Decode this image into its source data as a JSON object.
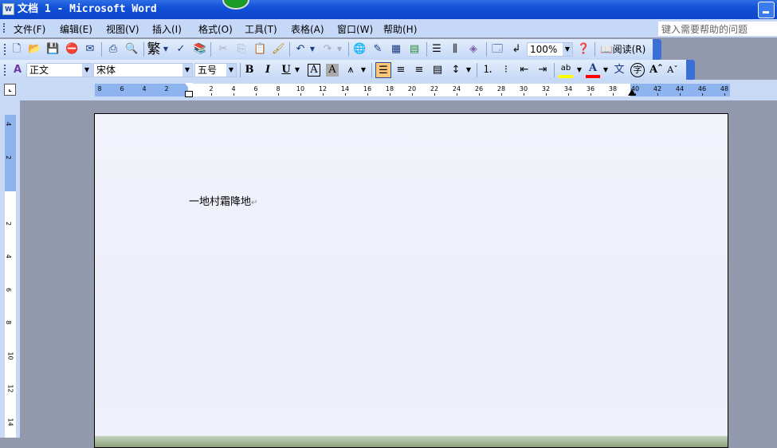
{
  "window": {
    "title": "文档 1 - Microsoft Word",
    "app_icon": "W"
  },
  "menu": [
    "文件(F)",
    "编辑(E)",
    "视图(V)",
    "插入(I)",
    "格式(O)",
    "工具(T)",
    "表格(A)",
    "窗口(W)",
    "帮助(H)"
  ],
  "help_placeholder": "键入需要帮助的问题",
  "standard_toolbar": {
    "zoom": "100%",
    "read_label": "阅读(R)",
    "traditional": "繁"
  },
  "format_toolbar": {
    "style": "正文",
    "font": "宋体",
    "size": "五号",
    "bold": "B",
    "italic": "I",
    "underline": "U",
    "char_border": "A",
    "char_shade": "A",
    "font_color": "A",
    "highlight_color": "#ffff00",
    "font_color_value": "#ff0000",
    "phonetic": "文",
    "enclose": "字"
  },
  "hruler": {
    "left_labels": [
      "8",
      "6",
      "4",
      "2"
    ],
    "right_labels": [
      "2",
      "4",
      "6",
      "8",
      "10",
      "12",
      "14",
      "16",
      "18",
      "20",
      "22",
      "24",
      "26",
      "28",
      "30",
      "32",
      "34",
      "36",
      "38",
      "40",
      "42",
      "44",
      "46",
      "48"
    ]
  },
  "vruler": {
    "top_labels": [
      "4",
      "2"
    ],
    "labels": [
      "2",
      "4",
      "6",
      "8",
      "10",
      "12",
      "14"
    ]
  },
  "document": {
    "text": "一地村霜降地",
    "para_mark": "↵"
  }
}
